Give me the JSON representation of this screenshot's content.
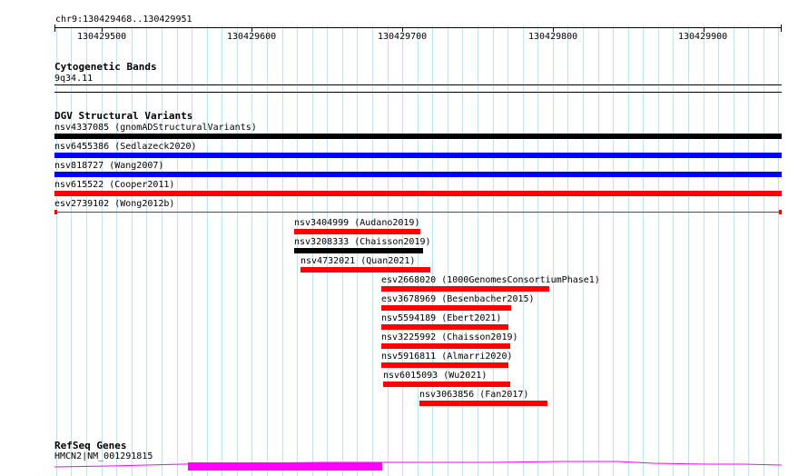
{
  "location": "chr9:130429468..130429951",
  "ruler": {
    "ticks": [
      "130429500",
      "130429600",
      "130429700",
      "130429800",
      "130429900"
    ]
  },
  "cytobands": {
    "title": "Cytogenetic Bands",
    "band": "9q34.11"
  },
  "dgv": {
    "title": "DGV Structural Variants",
    "variants": [
      {
        "label": "nsv4337085 (gnomADStructuralVariants)",
        "color": "#000000"
      },
      {
        "label": "nsv6455386 (Sedlazeck2020)",
        "color": "#0000ff"
      },
      {
        "label": "nsv818727 (Wang2007)",
        "color": "#0000ff"
      },
      {
        "label": "nsv615522 (Cooper2011)",
        "color": "#ff0000"
      },
      {
        "label": "esv2739102 (Wong2012b)",
        "color": "#ff0000"
      },
      {
        "label": "nsv3404999 (Audano2019)",
        "color": "#ff0000"
      },
      {
        "label": "nsv3208333 (Chaisson2019)",
        "color": "#000000"
      },
      {
        "label": "nsv4732021 (Quan2021)",
        "color": "#ff0000"
      },
      {
        "label": "esv2668020 (1000GenomesConsortiumPhase1)",
        "color": "#ff0000"
      },
      {
        "label": "esv3678969 (Besenbacher2015)",
        "color": "#ff0000"
      },
      {
        "label": "nsv5594189 (Ebert2021)",
        "color": "#ff0000"
      },
      {
        "label": "nsv3225992 (Chaisson2019)",
        "color": "#ff0000"
      },
      {
        "label": "nsv5916811 (Almarri2020)",
        "color": "#ff0000"
      },
      {
        "label": "nsv6015093 (Wu2021)",
        "color": "#ff0000"
      },
      {
        "label": "nsv3063856 (Fan2017)",
        "color": "#ff0000"
      }
    ]
  },
  "refseq": {
    "title": "RefSeq Genes",
    "gene": "HMCN2|NM_001291815",
    "color": "#ff00ff"
  }
}
